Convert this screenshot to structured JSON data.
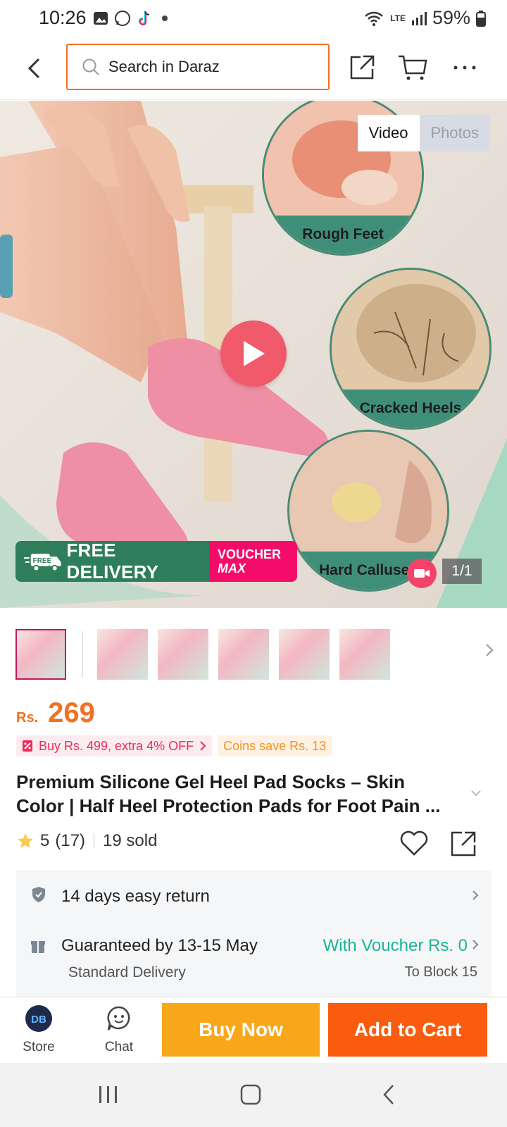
{
  "status_bar": {
    "time": "10:26",
    "battery": "59%",
    "network": "LTE"
  },
  "topnav": {
    "search_placeholder": "Search in Daraz"
  },
  "hero": {
    "tabs": [
      "Video",
      "Photos"
    ],
    "active_tab": "Video",
    "circles": [
      "Rough Feet",
      "Cracked Heels",
      "Hard Calluses"
    ],
    "banner_free": "FREE DELIVERY",
    "banner_free_badge": "FREE",
    "banner_voucher_1": "VOUCHER",
    "banner_voucher_2": "MAX",
    "page_count": "1/1"
  },
  "product": {
    "price_currency": "Rs.",
    "price": "269",
    "promo_1": "Buy Rs. 499, extra 4% OFF",
    "promo_2": "Coins save Rs. 13",
    "title_line_1": "Premium Silicone Gel Heel Pad Socks – Skin",
    "title_line_2": "Color | Half Heel Protection Pads for Foot Pain ...",
    "rating": "5",
    "review_count": "(17)",
    "sold": "19 sold"
  },
  "service": {
    "return_text": "14 days easy return",
    "delivery_text": "Guaranteed by 13-15 May",
    "delivery_sub": "Standard Delivery",
    "voucher_text": "With Voucher Rs. 0",
    "destination": "To Block 15"
  },
  "action_bar": {
    "store_label": "Store",
    "chat_label": "Chat",
    "buy_now": "Buy Now",
    "add_to_cart": "Add to Cart"
  },
  "colors": {
    "brand_orange": "#f36f21",
    "buy_now": "#f9a71a",
    "add_to_cart": "#f95c0e",
    "voucher_green": "#1bb394"
  }
}
